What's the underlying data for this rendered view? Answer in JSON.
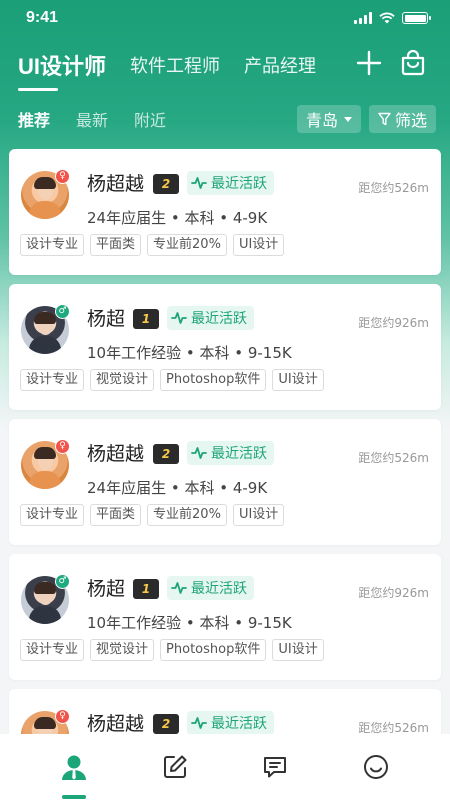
{
  "status_bar": {
    "time": "9:41"
  },
  "header": {
    "job_tabs": [
      {
        "label": "UI设计师",
        "active": true
      },
      {
        "label": "软件工程师",
        "active": false
      },
      {
        "label": "产品经理",
        "active": false
      }
    ],
    "icons": [
      "plus-icon",
      "bag-icon"
    ]
  },
  "sub_bar": {
    "tabs": [
      {
        "label": "推荐",
        "active": true
      },
      {
        "label": "最新",
        "active": false
      },
      {
        "label": "附近",
        "active": false
      }
    ],
    "city": "青岛",
    "filter_label": "筛选"
  },
  "candidates": [
    {
      "name": "杨超越",
      "gender": "female",
      "level": "2",
      "active_label": "最近活跃",
      "distance": "距您约526m",
      "info": "24年应届生 • 本科 • 4-9K",
      "tags": [
        "设计专业",
        "平面类",
        "专业前20%",
        "UI设计"
      ]
    },
    {
      "name": "杨超",
      "gender": "male",
      "level": "1",
      "active_label": "最近活跃",
      "distance": "距您约926m",
      "info": "10年工作经验 • 本科 • 9-15K",
      "tags": [
        "设计专业",
        "视觉设计",
        "Photoshop软件",
        "UI设计"
      ]
    },
    {
      "name": "杨超越",
      "gender": "female",
      "level": "2",
      "active_label": "最近活跃",
      "distance": "距您约526m",
      "info": "24年应届生 • 本科 • 4-9K",
      "tags": [
        "设计专业",
        "平面类",
        "专业前20%",
        "UI设计"
      ]
    },
    {
      "name": "杨超",
      "gender": "male",
      "level": "1",
      "active_label": "最近活跃",
      "distance": "距您约926m",
      "info": "10年工作经验 • 本科 • 9-15K",
      "tags": [
        "设计专业",
        "视觉设计",
        "Photoshop软件",
        "UI设计"
      ]
    },
    {
      "name": "杨超越",
      "gender": "female",
      "level": "2",
      "active_label": "最近活跃",
      "distance": "距您约526m",
      "info": "24年应届生 • 本科 • 4-9K",
      "tags": [
        "设计专业",
        "平面类",
        "专业前20%",
        "UI设计"
      ]
    }
  ],
  "tab_bar": {
    "items": [
      {
        "icon": "person-icon",
        "active": true
      },
      {
        "icon": "edit-icon",
        "active": false
      },
      {
        "icon": "message-icon",
        "active": false
      },
      {
        "icon": "smile-icon",
        "active": false
      }
    ]
  },
  "colors": {
    "primary": "#1da57a",
    "female": "#f0544a",
    "male": "#1fa97e",
    "badge_bg": "#2b2b2b",
    "badge_fg": "#f7c948"
  }
}
